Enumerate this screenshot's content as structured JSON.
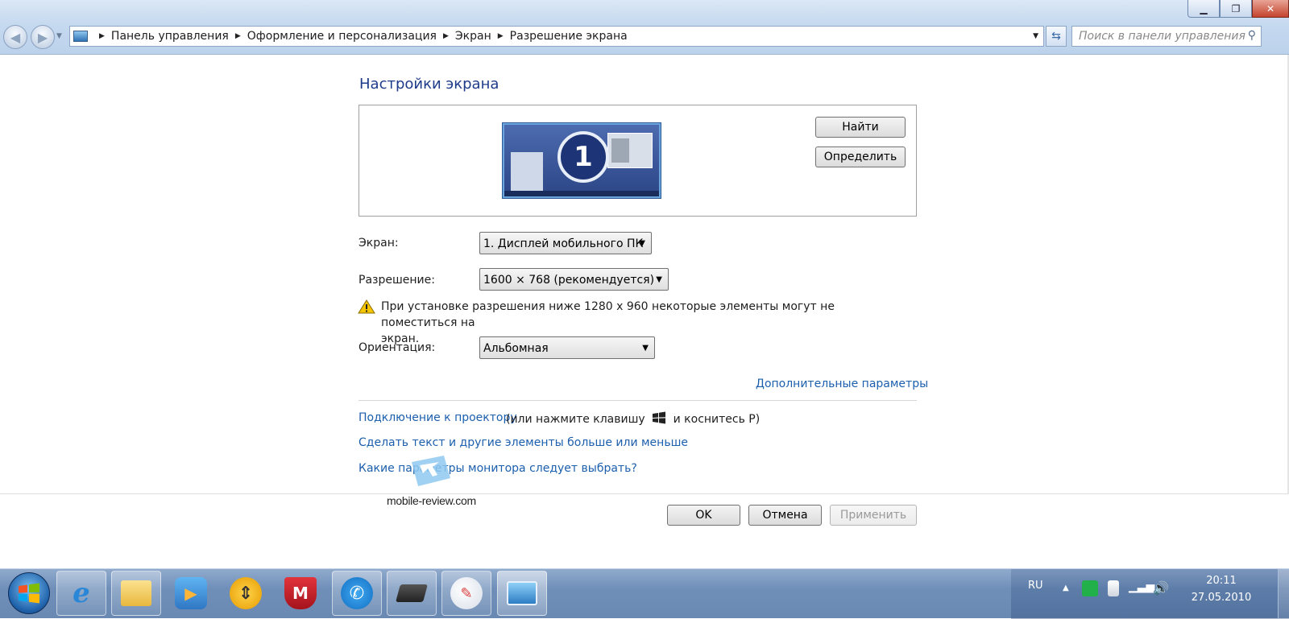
{
  "window": {
    "minimize_icon": "minimize-icon",
    "restore_icon": "restore-icon",
    "close_icon": "close-icon"
  },
  "address": {
    "crumbs": [
      "Панель управления",
      "Оформление и персонализация",
      "Экран",
      "Разрешение экрана"
    ],
    "search_placeholder": "Поиск в панели управления"
  },
  "page": {
    "title": "Настройки экрана",
    "monitor_number": "1",
    "detect_button": "Найти",
    "identify_button": "Определить",
    "screen_label": "Экран:",
    "screen_value": "1. Дисплей мобильного ПК",
    "resolution_label": "Разрешение:",
    "resolution_value": "1600 × 768 (рекомендуется)",
    "warning_line1": "При установке разрешения ниже 1280 x 960 некоторые элементы могут не поместиться на",
    "warning_line2": "экран.",
    "orientation_label": "Ориентация:",
    "orientation_value": "Альбомная",
    "advanced_link": "Дополнительные параметры",
    "projector_link": "Подключение к проектору",
    "projector_hint_before": "(или нажмите клавишу",
    "projector_hint_after": "и коснитесь P)",
    "text_size_link": "Сделать текст и другие элементы больше или меньше",
    "monitor_help_link": "Какие параметры монитора следует выбрать?",
    "ok_button": "OK",
    "cancel_button": "Отмена",
    "apply_button": "Применить"
  },
  "watermark": {
    "text": "mobile-review.com"
  },
  "taskbar": {
    "apps": [
      "internet-explorer-icon",
      "folder-icon",
      "media-player-icon",
      "sync-icon",
      "mcafee-icon",
      "phone-icon",
      "tablet-pen-icon",
      "paint-icon",
      "control-panel-icon"
    ],
    "language": "RU",
    "time": "20:11",
    "date": "27.05.2010"
  }
}
